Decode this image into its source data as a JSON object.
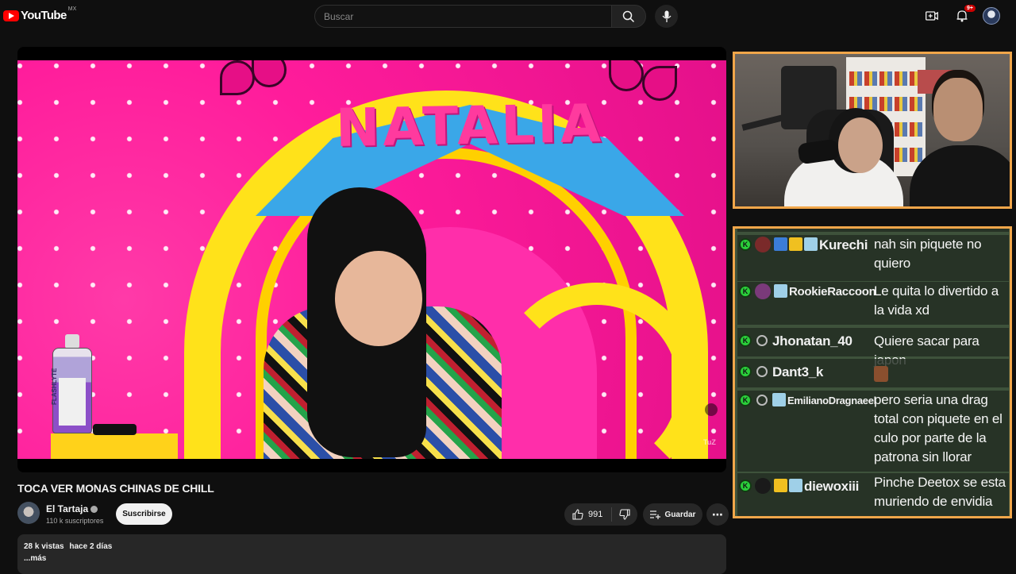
{
  "header": {
    "logo_text": "YouTube",
    "country_code": "MX",
    "search_placeholder": "Buscar",
    "notification_count": "9+",
    "icons": [
      "search-icon",
      "mic-icon",
      "create-icon",
      "bell-icon",
      "avatar"
    ]
  },
  "video": {
    "banner_text": "NATALIA",
    "bottle_label": "FLASHLYTE",
    "watermark": "TuZ",
    "title": "TOCA VER MONAS CHINAS DE CHILL",
    "channel": {
      "name": "El Tartaja",
      "subscribers": "110 k suscriptores",
      "subscribe_label": "Suscribirse"
    },
    "actions": {
      "likes": "991",
      "save_label": "Guardar"
    },
    "description": {
      "views": "28 k vistas",
      "age": "hace 2 días",
      "more_label": "...más"
    }
  },
  "chat": {
    "messages": [
      {
        "user": "Kurechi",
        "badges": [
          "arrow",
          "crown",
          "fox"
        ],
        "text": "nah sin piquete no quiero"
      },
      {
        "user": "RookieRaccoon",
        "badges": [
          "fox"
        ],
        "text": "Le quita lo divertido a la vida xd"
      },
      {
        "user": "Jhonatan_40",
        "badges": [],
        "text": "Quiere sacar para japon"
      },
      {
        "user": "Dant3_k",
        "badges": [],
        "text": ""
      },
      {
        "user": "EmilianoDragnaeel",
        "badges": [
          "fox"
        ],
        "text": "pero seria una drag total con piquete en el culo por parte de la patrona sin llorar"
      },
      {
        "user": "diewoxiii",
        "badges": [
          "crown",
          "fox"
        ],
        "text": "Pinche Deetox se esta muriendo de envidia"
      }
    ]
  },
  "colors": {
    "accent_orange": "#f0a64a",
    "chat_bg": "#3e523b",
    "kick_green": "#2acf3a",
    "youtube_red": "#ff0000"
  }
}
